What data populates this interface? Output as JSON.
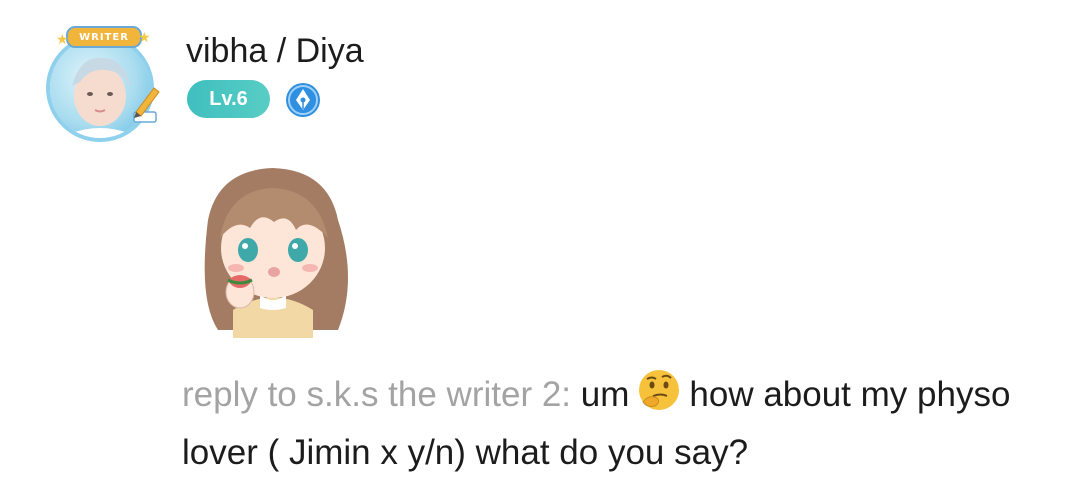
{
  "author": {
    "name": "vibha / Diya",
    "avatar_frame_label": "WRITER",
    "level": "Lv.6",
    "role_icon": "pen-nib-badge-icon"
  },
  "sticker": {
    "icon": "chibi-girl-eating-sticker"
  },
  "comment": {
    "reply_prefix": "reply to s.k.s the writer 2:",
    "text_before_emoji": "um",
    "emoji": "thinking-face-emoji",
    "text_after_emoji": "how about my physo lover ( Jimin x y/n) what do you say?"
  },
  "colors": {
    "level_badge": "#47c4c1",
    "role_badge": "#2f8fe0",
    "reply_prefix": "#a3a3a3",
    "text": "#1c1c1c"
  }
}
